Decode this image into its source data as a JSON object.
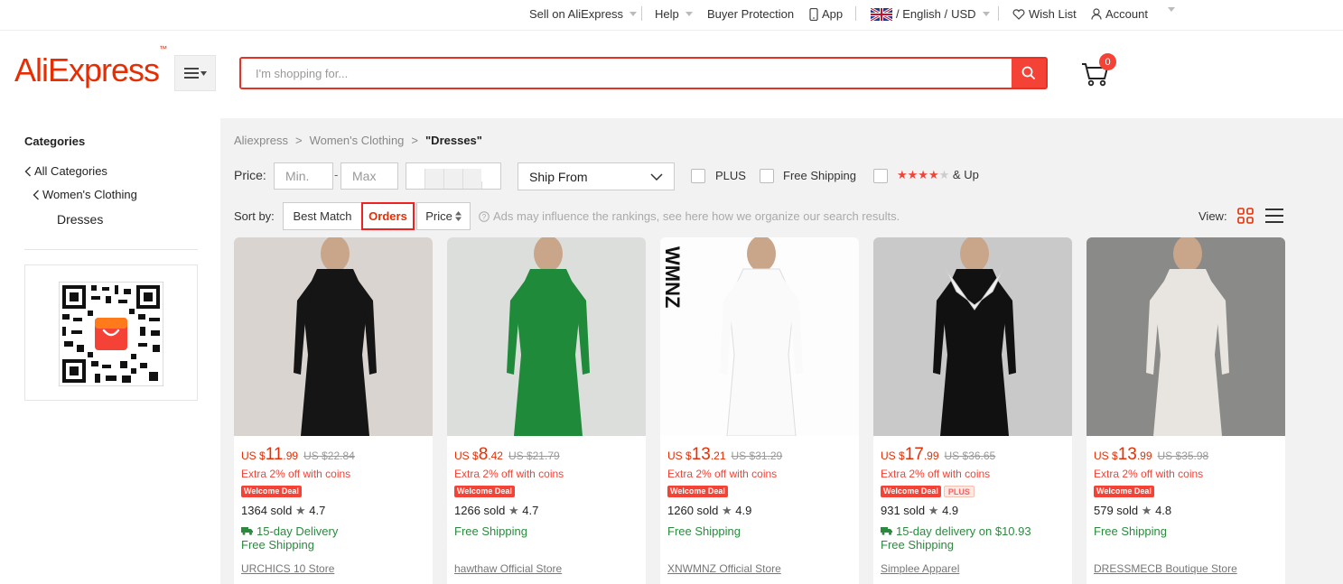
{
  "topbar": {
    "sell": "Sell on AliExpress",
    "help": "Help",
    "buyer_protection": "Buyer Protection",
    "app": "App",
    "language": "/ English /",
    "currency": "USD",
    "wishlist": "Wish List",
    "account": "Account"
  },
  "header": {
    "logo": "AliExpress",
    "search_placeholder": "I'm shopping for...",
    "cart_count": "0"
  },
  "sidebar": {
    "title": "Categories",
    "links": [
      "All Categories",
      "Women's Clothing",
      "Dresses"
    ]
  },
  "breadcrumb": [
    "Aliexpress",
    "Women's Clothing",
    "\"Dresses\""
  ],
  "filters": {
    "price_label": "Price:",
    "min_placeholder": "Min.",
    "max_placeholder": "Max",
    "dash": "-",
    "ship_from": "Ship From",
    "plus": "PLUS",
    "free_shipping": "Free Shipping",
    "rating_suffix": "& Up"
  },
  "sort": {
    "label": "Sort by:",
    "options": [
      "Best Match",
      "Orders",
      "Price"
    ],
    "active": "Orders",
    "ad_note": "Ads may influence the rankings, see here how we organize our search results.",
    "view_label": "View:"
  },
  "products": [
    {
      "currency": "US $",
      "price_int": "11",
      "price_dec": ".99",
      "old_price": "US $22.84",
      "coins": "Extra 2% off with coins",
      "badge": "Welcome Deal",
      "plus": "",
      "sold": "1364 sold",
      "rating": "4.7",
      "delivery": "15-day Delivery",
      "free_shipping": "Free Shipping",
      "store": "URCHICS 10 Store",
      "dress_color": "#151515"
    },
    {
      "currency": "US $",
      "price_int": "8",
      "price_dec": ".42",
      "old_price": "US $21.79",
      "coins": "Extra 2% off with coins",
      "badge": "Welcome Deal",
      "plus": "",
      "sold": "1266 sold",
      "rating": "4.7",
      "delivery": "",
      "free_shipping": "Free Shipping",
      "store": "hawthaw Official Store",
      "dress_color": "#1f8a3a"
    },
    {
      "currency": "US $",
      "price_int": "13",
      "price_dec": ".21",
      "old_price": "US $31.29",
      "coins": "Extra 2% off with coins",
      "badge": "Welcome Deal",
      "plus": "",
      "sold": "1260 sold",
      "rating": "4.9",
      "delivery": "",
      "free_shipping": "Free Shipping",
      "store": "XNWMNZ Official Store",
      "dress_color": "#fafafa",
      "brand_text": "WMNZ"
    },
    {
      "currency": "US $",
      "price_int": "17",
      "price_dec": ".99",
      "old_price": "US $36.65",
      "coins": "Extra 2% off with coins",
      "badge": "Welcome Deal",
      "plus": "PLUS",
      "sold": "931 sold",
      "rating": "4.9",
      "delivery": "15-day delivery on $10.93",
      "free_shipping": "Free Shipping",
      "store": "Simplee Apparel",
      "dress_color": "#111111"
    },
    {
      "currency": "US $",
      "price_int": "13",
      "price_dec": ".99",
      "old_price": "US $35.98",
      "coins": "Extra 2% off with coins",
      "badge": "Welcome Deal",
      "plus": "",
      "sold": "579 sold",
      "rating": "4.8",
      "delivery": "",
      "free_shipping": "Free Shipping",
      "store": "DRESSMECB Boutique Store",
      "dress_color": "#e8e4df"
    }
  ],
  "colors": {
    "accent": "#e62e04",
    "search_border": "#e43225",
    "green": "#2b8a3e"
  }
}
